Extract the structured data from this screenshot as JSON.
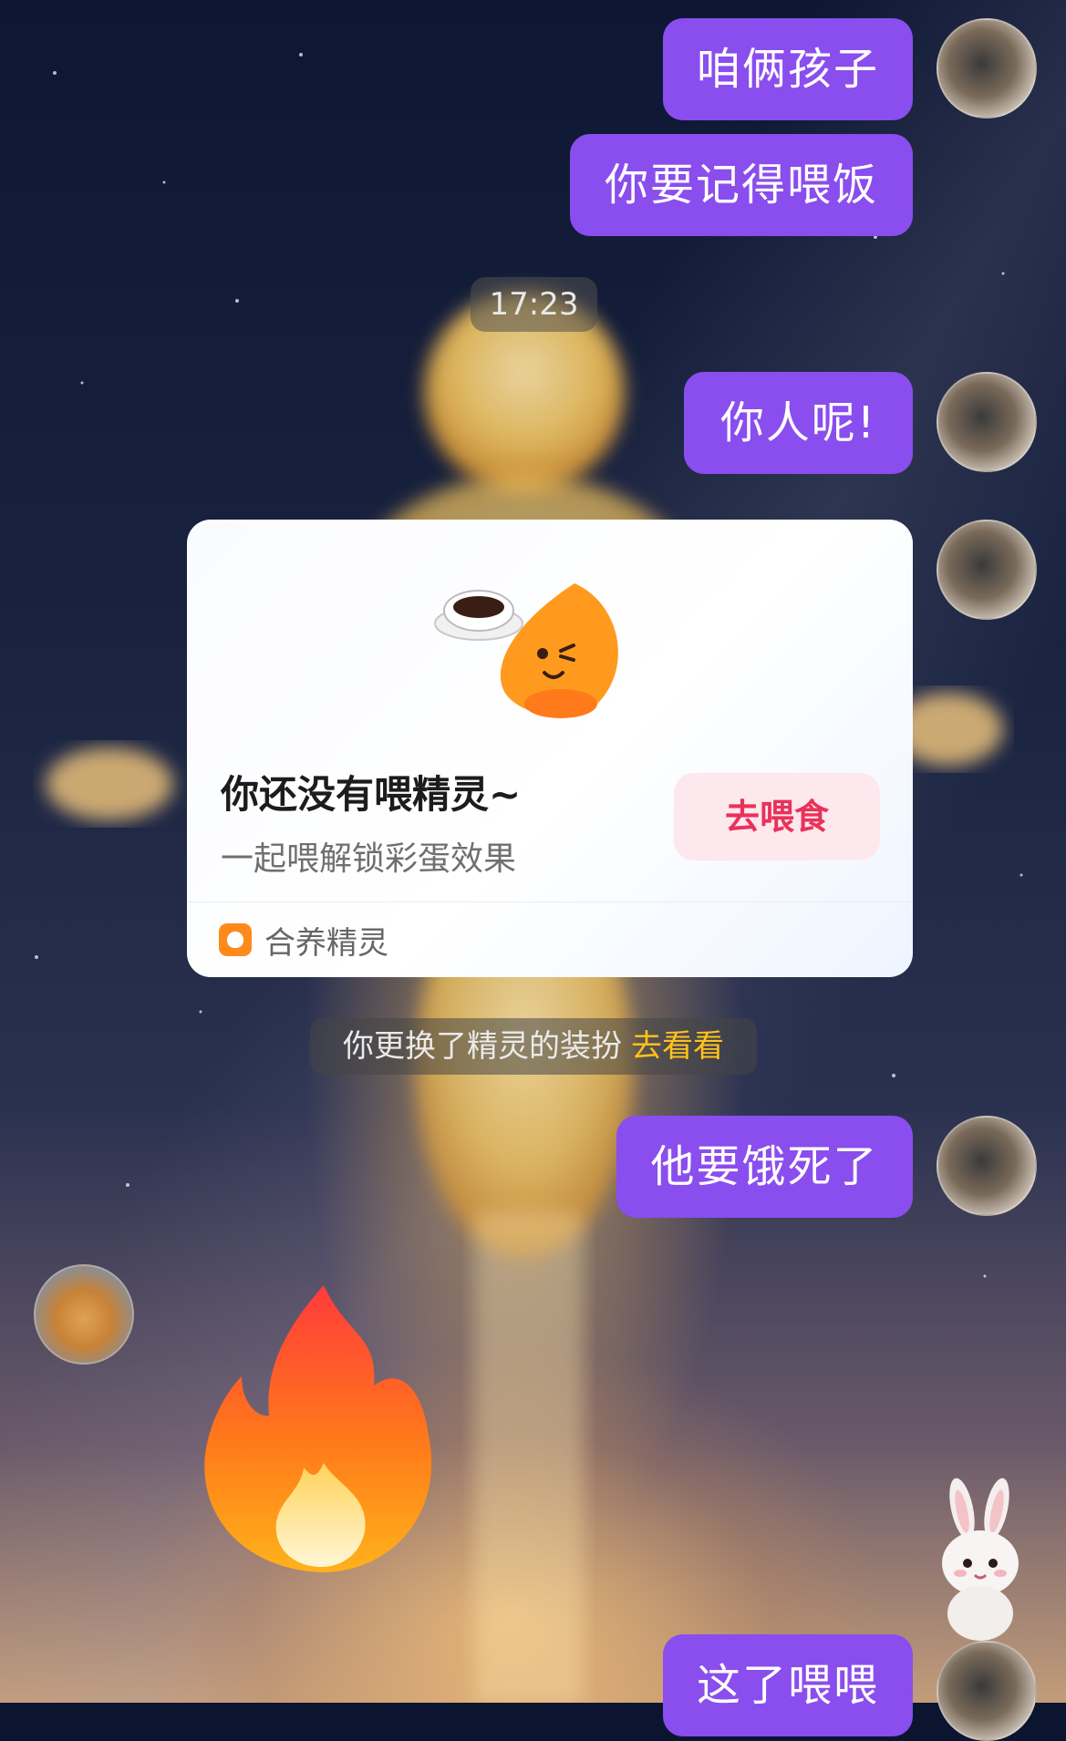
{
  "messages": [
    {
      "text": "咱俩孩子"
    },
    {
      "text": "你要记得喂饭"
    },
    {
      "text": "你人呢!"
    },
    {
      "text": "他要饿死了"
    },
    {
      "text": "这了喂喂"
    }
  ],
  "timestamp": "17:23",
  "card": {
    "title": "你还没有喂精灵~",
    "subtitle": "一起喂解锁彩蛋效果",
    "button_label": "去喂食",
    "footer_label": "合养精灵"
  },
  "notice": {
    "text": "你更换了精灵的装扮",
    "link": "去看看"
  },
  "colors": {
    "bubble": "#8a4dee",
    "button_text": "#e8325a",
    "notice_link": "#ffc21a"
  },
  "stickers": [
    "fire-emoji-sticker",
    "bunny-sticker"
  ]
}
